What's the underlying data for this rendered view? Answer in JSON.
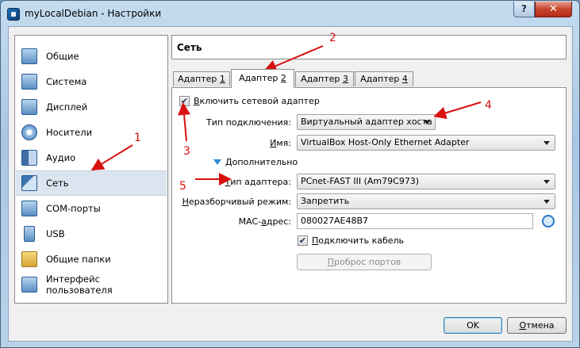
{
  "window": {
    "title": "myLocalDebian - Настройки",
    "help_label": "?",
    "close_label": "✕"
  },
  "sidebar": {
    "items": [
      {
        "label": "Общие",
        "icon": "general-icon"
      },
      {
        "label": "Система",
        "icon": "system-chip-icon"
      },
      {
        "label": "Дисплей",
        "icon": "display-monitor-icon"
      },
      {
        "label": "Носители",
        "icon": "storage-disk-icon"
      },
      {
        "label": "Аудио",
        "icon": "audio-speaker-icon"
      },
      {
        "label": "Сеть",
        "icon": "network-icon",
        "selected": true
      },
      {
        "label": "COM-порты",
        "icon": "serial-port-icon"
      },
      {
        "label": "USB",
        "icon": "usb-icon"
      },
      {
        "label": "Общие папки",
        "icon": "shared-folder-icon"
      },
      {
        "label": "Интерфейс пользователя",
        "icon": "user-interface-icon"
      }
    ]
  },
  "section": {
    "title": "Сеть"
  },
  "tabs": [
    {
      "prefix": "Адаптер ",
      "key": "1"
    },
    {
      "prefix": "Адаптер ",
      "key": "2",
      "active": true
    },
    {
      "prefix": "Адаптер ",
      "key": "3"
    },
    {
      "prefix": "Адаптер ",
      "key": "4"
    }
  ],
  "adapter": {
    "enable_key": "В",
    "enable_rest": "ключить сетевой адаптер",
    "enable_checked": true,
    "connection_type_label": "Тип подключения:",
    "connection_type_value": "Виртуальный адаптер хоста",
    "name_key": "И",
    "name_rest": "мя:",
    "name_value": "VirtualBox Host-Only Ethernet Adapter",
    "advanced_key": "Д",
    "advanced_rest": "ополнительно",
    "adapter_type_key": "Т",
    "adapter_type_rest": "ип адаптера:",
    "adapter_type_value": "PCnet-FAST III (Am79C973)",
    "promisc_key": "Н",
    "promisc_rest": "еразборчивый режим:",
    "promisc_value": "Запретить",
    "mac_label_pre": "MAC-",
    "mac_key": "а",
    "mac_label_post": "дрес:",
    "mac_value": "080027AE48B7",
    "cable_key": "П",
    "cable_rest": "одключить кабель",
    "cable_checked": true,
    "port_fwd_key": "П",
    "port_fwd_rest": "роброс портов",
    "check_mark": "✔"
  },
  "annotations": [
    "1",
    "2",
    "3",
    "4",
    "5"
  ],
  "colors": {
    "annotation": "#d8100f",
    "selection": "#dbe5ef"
  },
  "buttons": {
    "ok": "OK",
    "cancel_key": "О",
    "cancel_rest": "тмена"
  }
}
